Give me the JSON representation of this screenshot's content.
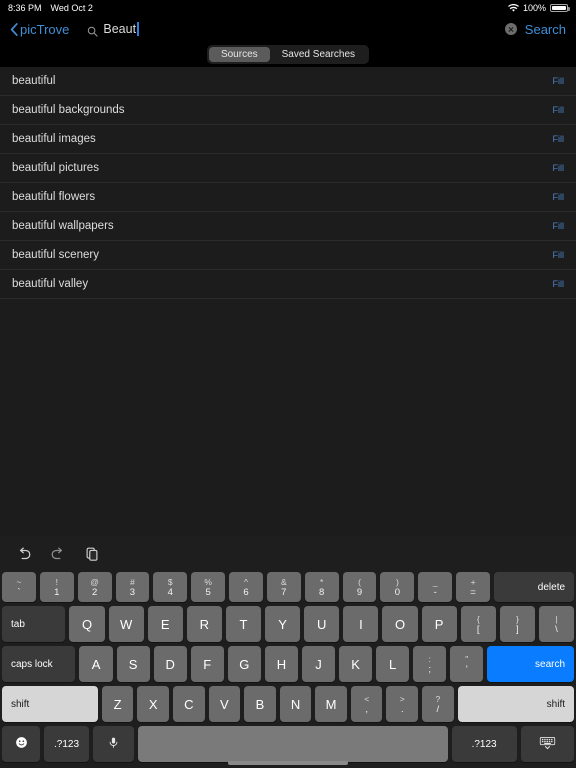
{
  "status_bar": {
    "time": "8:36 PM",
    "date": "Wed Oct 2",
    "battery_percent": "100%",
    "wifi_icon": "wifi-icon",
    "battery_icon": "battery-icon"
  },
  "nav": {
    "back_label": "picTrove",
    "back_icon": "chevron-left-icon",
    "search_icon": "search-icon",
    "search_value": "Beaut",
    "search_placeholder": "Search",
    "clear_icon": "clear-circle-icon",
    "search_action": "Search",
    "accent_color": "#3f8fd8"
  },
  "segmented": {
    "items": [
      {
        "label": "Sources",
        "selected": true
      },
      {
        "label": "Saved Searches",
        "selected": false
      }
    ]
  },
  "suggestions": {
    "fill_label": "Fill",
    "items": [
      {
        "label": "beautiful",
        "action": "Fill"
      },
      {
        "label": "beautiful backgrounds",
        "action": "Fill"
      },
      {
        "label": "beautiful images",
        "action": "Fill"
      },
      {
        "label": "beautiful pictures",
        "action": "Fill"
      },
      {
        "label": "beautiful flowers",
        "action": "Fill"
      },
      {
        "label": "beautiful wallpapers",
        "action": "Fill"
      },
      {
        "label": "beautiful scenery",
        "action": "Fill"
      },
      {
        "label": "beautiful valley",
        "action": "Fill"
      }
    ]
  },
  "keyboard": {
    "toolbar": [
      {
        "icon": "undo-icon"
      },
      {
        "icon": "redo-icon"
      },
      {
        "icon": "paste-icon"
      }
    ],
    "row_numbers": [
      {
        "top": "~",
        "bot": "`"
      },
      {
        "top": "!",
        "bot": "1"
      },
      {
        "top": "@",
        "bot": "2"
      },
      {
        "top": "#",
        "bot": "3"
      },
      {
        "top": "$",
        "bot": "4"
      },
      {
        "top": "%",
        "bot": "5"
      },
      {
        "top": "^",
        "bot": "6"
      },
      {
        "top": "&",
        "bot": "7"
      },
      {
        "top": "*",
        "bot": "8"
      },
      {
        "top": "(",
        "bot": "9"
      },
      {
        "top": ")",
        "bot": "0"
      },
      {
        "top": "_",
        "bot": "-"
      },
      {
        "top": "+",
        "bot": "="
      }
    ],
    "delete_label": "delete",
    "tab_label": "tab",
    "row_top": [
      "Q",
      "W",
      "E",
      "R",
      "T",
      "Y",
      "U",
      "I",
      "O",
      "P"
    ],
    "row_top_extra": [
      {
        "top": "{",
        "bot": "["
      },
      {
        "top": "}",
        "bot": "]"
      },
      {
        "top": "|",
        "bot": "\\"
      }
    ],
    "caps_label": "caps lock",
    "row_home": [
      "A",
      "S",
      "D",
      "F",
      "G",
      "H",
      "J",
      "K",
      "L"
    ],
    "row_home_extra": [
      {
        "top": ":",
        "bot": ";"
      },
      {
        "top": "\"",
        "bot": "'"
      }
    ],
    "search_key_label": "search",
    "shift_left_label": "shift",
    "shift_right_label": "shift",
    "row_shift": [
      "Z",
      "X",
      "C",
      "V",
      "B",
      "N",
      "M"
    ],
    "row_shift_extra": [
      {
        "top": "<",
        "bot": ","
      },
      {
        "top": ">",
        "bot": "."
      },
      {
        "top": "?",
        "bot": "/"
      }
    ],
    "bottom": {
      "emoji_icon": "emoji-icon",
      "numeric_left_label": ".?123",
      "mic_icon": "microphone-icon",
      "space_label": "",
      "numeric_right_label": ".?123",
      "dismiss_icon": "hide-keyboard-icon"
    }
  }
}
